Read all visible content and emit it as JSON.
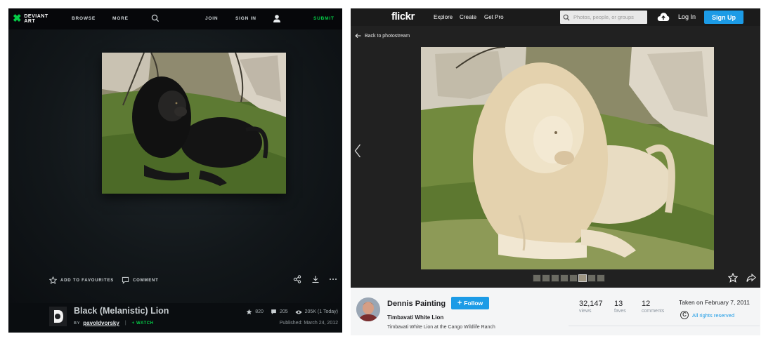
{
  "deviantart": {
    "logo": {
      "line1": "DEVIANT",
      "line2": "ART"
    },
    "nav": {
      "browse": "BROWSE",
      "more": "MORE",
      "join": "JOIN",
      "sign_in": "SIGN IN",
      "submit": "SUBMIT"
    },
    "actions": {
      "add_to_favourites": "ADD TO FAVOURITES",
      "comment": "COMMENT"
    },
    "deviation": {
      "title": "Black (Melanistic) Lion",
      "by": "BY",
      "author": "pavoldvorsky",
      "separator": "|",
      "watch": "+ WATCH",
      "favourites": "820",
      "comments": "205",
      "views": "205K (1 Today)",
      "published": "Published: March 24, 2012"
    },
    "colors": {
      "accent": "#05cc47",
      "background": "#0a0d10"
    }
  },
  "flickr": {
    "logo": "flickr",
    "nav": {
      "explore": "Explore",
      "create": "Create",
      "get_pro": "Get Pro"
    },
    "search": {
      "placeholder": "Photos, people, or groups"
    },
    "login": "Log In",
    "signup": "Sign Up",
    "back_link": "Back to photostream",
    "owner": {
      "name": "Dennis Painting",
      "follow_label": "Follow"
    },
    "photo": {
      "title": "Timbavati White Lion",
      "description": "Timbavati White Lion at the Cango Wildlife Ranch",
      "views": {
        "value": "32,147",
        "label": "views"
      },
      "faves": {
        "value": "13",
        "label": "faves"
      },
      "comments": {
        "value": "12",
        "label": "comments"
      },
      "taken": "Taken on February 7, 2011",
      "license": "All rights reserved"
    },
    "filmstrip": {
      "count": 8,
      "active_index": 5
    },
    "colors": {
      "accent": "#1c9be6",
      "panel": "#f4f5f6"
    }
  }
}
